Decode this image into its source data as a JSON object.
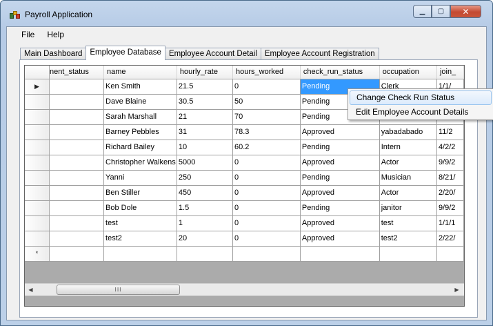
{
  "window": {
    "title": "Payroll Application"
  },
  "menu": {
    "items": [
      "File",
      "Help"
    ]
  },
  "tabs": [
    {
      "label": "Main Dashboard",
      "active": false
    },
    {
      "label": "Employee Database",
      "active": true
    },
    {
      "label": "Employee Account Detail",
      "active": false
    },
    {
      "label": "Employee Account Registration",
      "active": false
    }
  ],
  "grid": {
    "columns": [
      "nent_status",
      "name",
      "hourly_rate",
      "hours_worked",
      "check_run_status",
      "occupation",
      "join_"
    ],
    "rows": [
      {
        "marker": "▶",
        "cells": [
          "",
          "Ken Smith",
          "21.5",
          "0",
          "Pending",
          "Clerk",
          "1/1/"
        ]
      },
      {
        "marker": "",
        "cells": [
          "",
          "Dave Blaine",
          "30.5",
          "50",
          "Pending",
          "",
          ""
        ]
      },
      {
        "marker": "",
        "cells": [
          "",
          "Sarah Marshall",
          "21",
          "70",
          "Pending",
          "",
          ""
        ]
      },
      {
        "marker": "",
        "cells": [
          "",
          "Barney Pebbles",
          "31",
          "78.3",
          "Approved",
          "yabadabado",
          "11/2"
        ]
      },
      {
        "marker": "",
        "cells": [
          "",
          "Richard Bailey",
          "10",
          "60.2",
          "Pending",
          "Intern",
          "4/2/2"
        ]
      },
      {
        "marker": "",
        "cells": [
          "",
          "Christopher Walkens",
          "5000",
          "0",
          "Approved",
          "Actor",
          "9/9/2"
        ]
      },
      {
        "marker": "",
        "cells": [
          "",
          "Yanni",
          "250",
          "0",
          "Pending",
          "Musician",
          "8/21/"
        ]
      },
      {
        "marker": "",
        "cells": [
          "",
          "Ben Stiller",
          "450",
          "0",
          "Approved",
          "Actor",
          "2/20/"
        ]
      },
      {
        "marker": "",
        "cells": [
          "",
          "Bob Dole",
          "1.5",
          "0",
          "Pending",
          "janitor",
          "9/9/2"
        ]
      },
      {
        "marker": "",
        "cells": [
          "",
          "test",
          "1",
          "0",
          "Approved",
          "test",
          "1/1/1"
        ]
      },
      {
        "marker": "",
        "cells": [
          "",
          "test2",
          "20",
          "0",
          "Approved",
          "test2",
          "2/22/"
        ]
      },
      {
        "marker": "*",
        "cells": [
          "",
          "",
          "",
          "",
          "",
          "",
          ""
        ]
      }
    ],
    "selected": {
      "row": 0,
      "col": 4
    },
    "scroll_thumb_glyph": "III"
  },
  "context_menu": {
    "items": [
      "Change Check Run Status",
      "Edit Employee Account Details"
    ],
    "highlighted": 0
  },
  "colors": {
    "selection": "#3399ff",
    "close_button": "#c44a32"
  }
}
